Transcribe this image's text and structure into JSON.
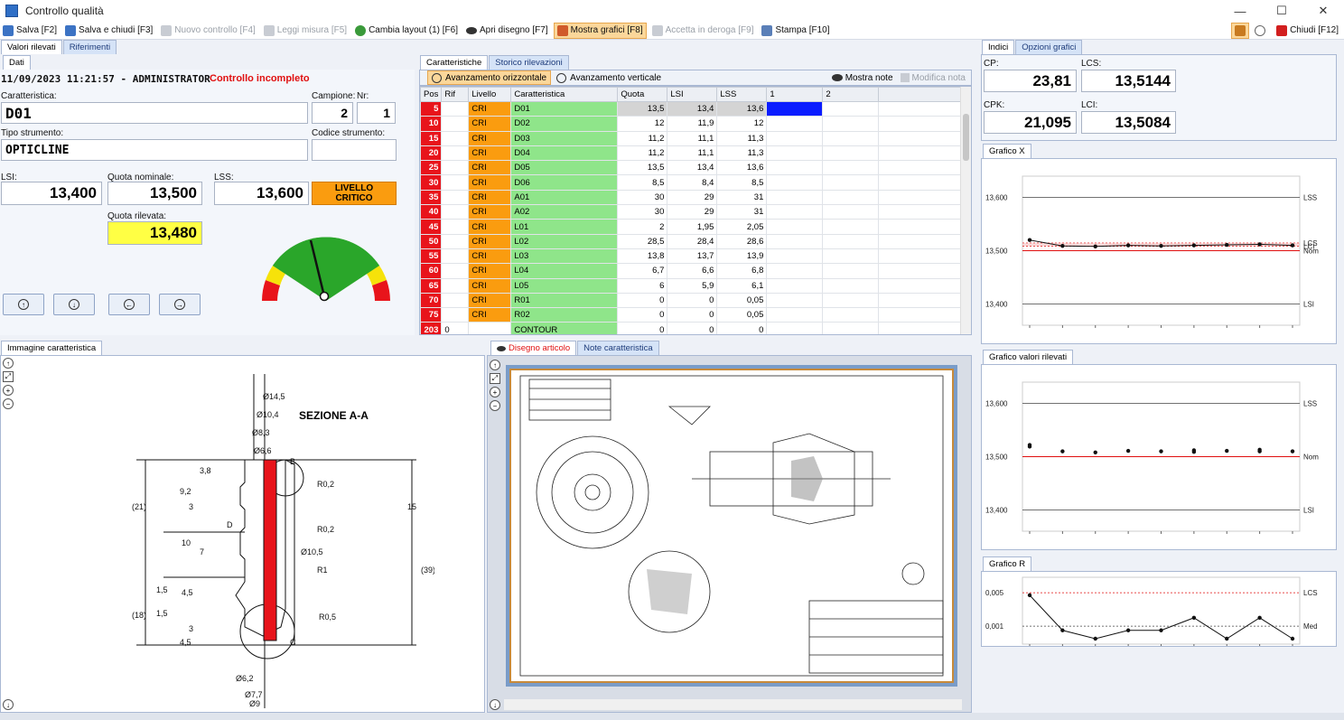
{
  "window": {
    "title": "Controllo qualità",
    "minimize": "—",
    "maximize": "☐",
    "close": "✕"
  },
  "toolbar": {
    "salva": "Salva [F2]",
    "salva_chiudi": "Salva e chiudi [F3]",
    "nuovo": "Nuovo controllo [F4]",
    "leggi": "Leggi misura [F5]",
    "cambia": "Cambia layout (1) [F6]",
    "apri": "Apri disegno [F7]",
    "mostra": "Mostra grafici [F8]",
    "accetta": "Accetta in deroga [F9]",
    "stampa": "Stampa [F10]",
    "chiudi": "Chiudi [F12]"
  },
  "left": {
    "tabs": [
      "Valori rilevati",
      "Riferimenti"
    ],
    "subtab": "Dati",
    "header": "11/09/2023 11:21:57 - ADMINISTRATOR",
    "status": "Controllo incompleto",
    "caratteristica_label": "Caratteristica:",
    "caratteristica": "D01",
    "campione_label": "Campione:",
    "campione": "2",
    "nr_label": "Nr:",
    "nr": "1",
    "tipo_label": "Tipo strumento:",
    "tipo": "OPTICLINE",
    "codice_label": "Codice strumento:",
    "codice": "",
    "lsi_label": "LSI:",
    "lsi": "13,400",
    "nominale_label": "Quota nominale:",
    "nominale": "13,500",
    "lss_label": "LSS:",
    "lss": "13,600",
    "livello": "LIVELLO CRITICO",
    "rilevata_label": "Quota rilevata:",
    "rilevata": "13,480",
    "nav": [
      "↑",
      "↓",
      "←",
      "→"
    ]
  },
  "grid": {
    "tabs": [
      "Caratteristiche",
      "Storico rilevazioni"
    ],
    "btn_orizz": "Avanzamento orizzontale",
    "btn_vert": "Avanzamento verticale",
    "mostra_note": "Mostra note",
    "modifica_nota": "Modifica nota",
    "columns": [
      "Pos",
      "Rif",
      "Livello",
      "Caratteristica",
      "Quota",
      "LSI",
      "LSS",
      "1",
      "2"
    ],
    "rows": [
      [
        "5",
        "",
        "CRI",
        "D01",
        "13,5",
        "13,4",
        "13,6"
      ],
      [
        "10",
        "",
        "CRI",
        "D02",
        "12",
        "11,9",
        "12"
      ],
      [
        "15",
        "",
        "CRI",
        "D03",
        "11,2",
        "11,1",
        "11,3"
      ],
      [
        "20",
        "",
        "CRI",
        "D04",
        "11,2",
        "11,1",
        "11,3"
      ],
      [
        "25",
        "",
        "CRI",
        "D05",
        "13,5",
        "13,4",
        "13,6"
      ],
      [
        "30",
        "",
        "CRI",
        "D06",
        "8,5",
        "8,4",
        "8,5"
      ],
      [
        "35",
        "",
        "CRI",
        "A01",
        "30",
        "29",
        "31"
      ],
      [
        "40",
        "",
        "CRI",
        "A02",
        "30",
        "29",
        "31"
      ],
      [
        "45",
        "",
        "CRI",
        "L01",
        "2",
        "1,95",
        "2,05"
      ],
      [
        "50",
        "",
        "CRI",
        "L02",
        "28,5",
        "28,4",
        "28,6"
      ],
      [
        "55",
        "",
        "CRI",
        "L03",
        "13,8",
        "13,7",
        "13,9"
      ],
      [
        "60",
        "",
        "CRI",
        "L04",
        "6,7",
        "6,6",
        "6,8"
      ],
      [
        "65",
        "",
        "CRI",
        "L05",
        "6",
        "5,9",
        "6,1"
      ],
      [
        "70",
        "",
        "CRI",
        "R01",
        "0",
        "0",
        "0,05"
      ],
      [
        "75",
        "",
        "CRI",
        "R02",
        "0",
        "0",
        "0,05"
      ],
      [
        "203",
        "0",
        "",
        "CONTOUR",
        "0",
        "0",
        "0"
      ]
    ]
  },
  "image_panel": {
    "tab": "Immagine caratteristica",
    "section": "SEZIONE A-A",
    "labels": [
      "B",
      "C",
      "D",
      "R0,2",
      "R0,2",
      "R1",
      "R0,5",
      "Ø14,5",
      "Ø10,4",
      "Ø8,3",
      "Ø6,6",
      "Ø10,5",
      "Ø6,2",
      "Ø7,7",
      "Ø9",
      "(21)",
      "(18)",
      "(39)",
      "15",
      "10",
      "1,5",
      "1,5",
      "4,5",
      "3,8",
      "9,2",
      "7",
      "4,5",
      "3",
      "3"
    ]
  },
  "drawing_panel": {
    "tabs": [
      "Disegno articolo",
      "Note caratteristica"
    ]
  },
  "right": {
    "tabs": [
      "Indici",
      "Opzioni grafici"
    ],
    "cp_label": "CP:",
    "cp": "23,81",
    "lcs_label": "LCS:",
    "lcs": "13,5144",
    "cpk_label": "CPK:",
    "cpk": "21,095",
    "lci_label": "LCI:",
    "lci": "13,5084",
    "grafico_x": "Grafico X",
    "grafico_valori": "Grafico valori rilevati",
    "grafico_r": "Grafico R"
  },
  "chart_data": [
    {
      "type": "line",
      "title": "Grafico X",
      "ylim": [
        13.37,
        13.63
      ],
      "yticks": [
        "13,600",
        "13,500",
        "13,400"
      ],
      "ref_lines": [
        {
          "label": "LSS",
          "value": 13.6
        },
        {
          "label": "LCS",
          "value": 13.5144
        },
        {
          "label": "LCI",
          "value": 13.5084
        },
        {
          "label": "Nom",
          "value": 13.5
        },
        {
          "label": "LSI",
          "value": 13.4
        }
      ],
      "x": [
        1,
        2,
        3,
        4,
        5,
        6,
        7,
        8,
        9
      ],
      "values": [
        13.52,
        13.509,
        13.508,
        13.51,
        13.509,
        13.51,
        13.511,
        13.512,
        13.51
      ]
    },
    {
      "type": "scatter",
      "title": "Grafico valori rilevati",
      "ylim": [
        13.37,
        13.63
      ],
      "yticks": [
        "13,600",
        "13,500",
        "13,400"
      ],
      "ref_lines": [
        {
          "label": "LSS",
          "value": 13.6
        },
        {
          "label": "Nom",
          "value": 13.5
        },
        {
          "label": "LSI",
          "value": 13.4
        }
      ],
      "points": [
        [
          1,
          13.522
        ],
        [
          1,
          13.519
        ],
        [
          2,
          13.51
        ],
        [
          3,
          13.508
        ],
        [
          4,
          13.511
        ],
        [
          5,
          13.51
        ],
        [
          6,
          13.509
        ],
        [
          6,
          13.512
        ],
        [
          7,
          13.511
        ],
        [
          8,
          13.513
        ],
        [
          8,
          13.51
        ],
        [
          9,
          13.51
        ]
      ]
    },
    {
      "type": "line",
      "title": "Grafico R",
      "ylim": [
        -0.0005,
        0.0062
      ],
      "yticks": [
        "0,005",
        "0,001"
      ],
      "ref_lines": [
        {
          "label": "LCS",
          "value": 0.005
        },
        {
          "label": "Med",
          "value": 0.001
        }
      ],
      "x": [
        1,
        2,
        3,
        4,
        5,
        6,
        7,
        8,
        9
      ],
      "values": [
        0.0047,
        0.0005,
        -0.0005,
        0.0005,
        0.0005,
        0.002,
        -0.0005,
        0.002,
        -0.0005
      ]
    }
  ],
  "colors": {
    "critico": "#fa9c0f",
    "rilevata": "#ffff44",
    "pos": "#e8141b",
    "green": "#8fe58a",
    "selected": "#0a1cff"
  }
}
